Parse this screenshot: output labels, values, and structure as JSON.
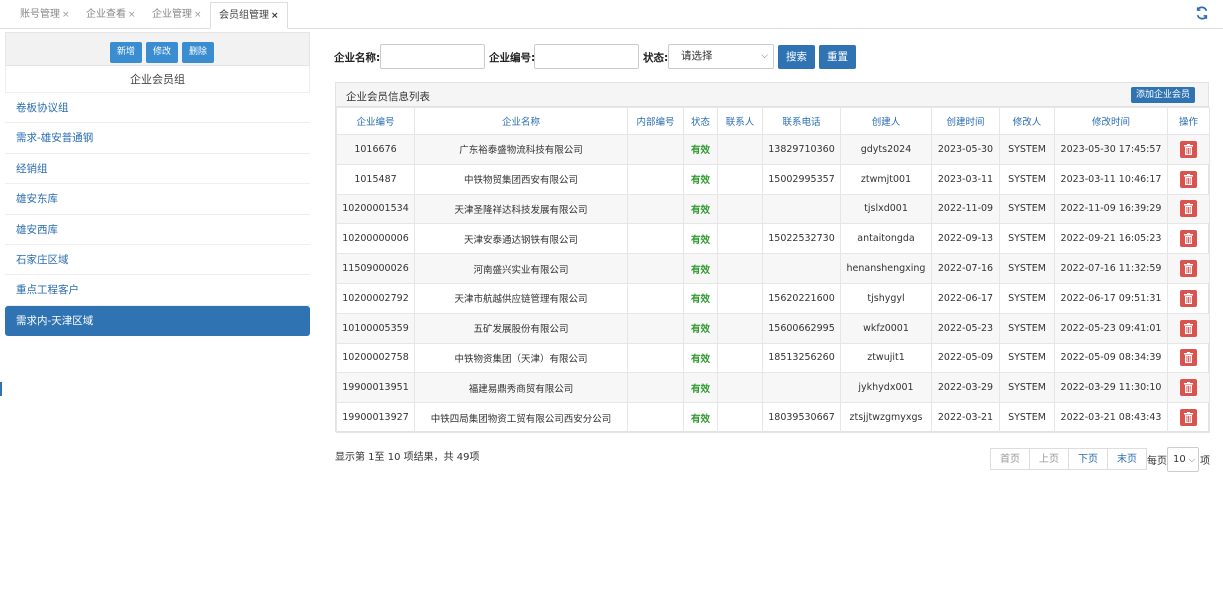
{
  "tabs": [
    {
      "label": "账号管理"
    },
    {
      "label": "企业查看"
    },
    {
      "label": "企业管理"
    },
    {
      "label": "会员组管理"
    }
  ],
  "tab_close": "×",
  "left": {
    "buttons": {
      "add": "新增",
      "edit": "修改",
      "delete": "删除"
    },
    "title": "企业会员组",
    "groups": [
      "卷板协议组",
      "需求-雄安普通钢",
      "经销组",
      "雄安东库",
      "雄安西库",
      "石家庄区域",
      "重点工程客户",
      "需求内-天津区域"
    ]
  },
  "search": {
    "company_name_label": "企业名称:",
    "company_name_value": "",
    "company_code_label": "企业编号:",
    "company_code_value": "",
    "status_label": "状态:",
    "status_value": "请选择",
    "search_button": "搜索",
    "reset_button": "重置"
  },
  "panel": {
    "title": "企业会员信息列表",
    "add_button": "添加企业会员"
  },
  "table": {
    "headers": [
      "企业编号",
      "企业名称",
      "内部编号",
      "状态",
      "联系人",
      "联系电话",
      "创建人",
      "创建时间",
      "修改人",
      "修改时间",
      "操作"
    ],
    "rows": [
      [
        "1016676",
        "广东裕泰盛物流科技有限公司",
        "",
        "有效",
        "",
        "13829710360",
        "gdyts2024",
        "2023-05-30",
        "SYSTEM",
        "2023-05-30 17:45:57"
      ],
      [
        "1015487",
        "中铁物贸集团西安有限公司",
        "",
        "有效",
        "",
        "15002995357",
        "ztwmjt001",
        "2023-03-11",
        "SYSTEM",
        "2023-03-11 10:46:17"
      ],
      [
        "10200001534",
        "天津圣隆祥达科技发展有限公司",
        "",
        "有效",
        "",
        "",
        "tjslxd001",
        "2022-11-09",
        "SYSTEM",
        "2022-11-09 16:39:29"
      ],
      [
        "10200000006",
        "天津安泰通达钢铁有限公司",
        "",
        "有效",
        "",
        "15022532730",
        "antaitongda",
        "2022-09-13",
        "SYSTEM",
        "2022-09-21 16:05:23"
      ],
      [
        "11509000026",
        "河南盛兴实业有限公司",
        "",
        "有效",
        "",
        "",
        "henanshengxing",
        "2022-07-16",
        "SYSTEM",
        "2022-07-16 11:32:59"
      ],
      [
        "10200002792",
        "天津市航越供应链管理有限公司",
        "",
        "有效",
        "",
        "15620221600",
        "tjshygyl",
        "2022-06-17",
        "SYSTEM",
        "2022-06-17 09:51:31"
      ],
      [
        "10100005359",
        "五矿发展股份有限公司",
        "",
        "有效",
        "",
        "15600662995",
        "wkfz0001",
        "2022-05-23",
        "SYSTEM",
        "2022-05-23 09:41:01"
      ],
      [
        "10200002758",
        "中铁物资集团（天津）有限公司",
        "",
        "有效",
        "",
        "18513256260",
        "ztwujit1",
        "2022-05-09",
        "SYSTEM",
        "2022-05-09 08:34:39"
      ],
      [
        "19900013951",
        "福建易鼎秀商贸有限公司",
        "",
        "有效",
        "",
        "",
        "jykhydx001",
        "2022-03-29",
        "SYSTEM",
        "2022-03-29 11:30:10"
      ],
      [
        "19900013927",
        "中铁四局集团物资工贸有限公司西安分公司",
        "",
        "有效",
        "",
        "18039530667",
        "ztsjjtwzgmyxgs",
        "2022-03-21",
        "SYSTEM",
        "2022-03-21 08:43:43"
      ]
    ]
  },
  "footer": {
    "summary": "显示第 1至 10 项结果，共 49项",
    "pager": {
      "first": "首页",
      "prev": "上页",
      "next": "下页",
      "last": "末页"
    },
    "per_page_prefix": "每页",
    "per_page_value": "10",
    "per_page_suffix": "项"
  },
  "colors": {
    "primary": "#2f73b3",
    "button": "#3a8dd1",
    "status_valid": "#2e9a2e",
    "delete": "#d9534f"
  }
}
